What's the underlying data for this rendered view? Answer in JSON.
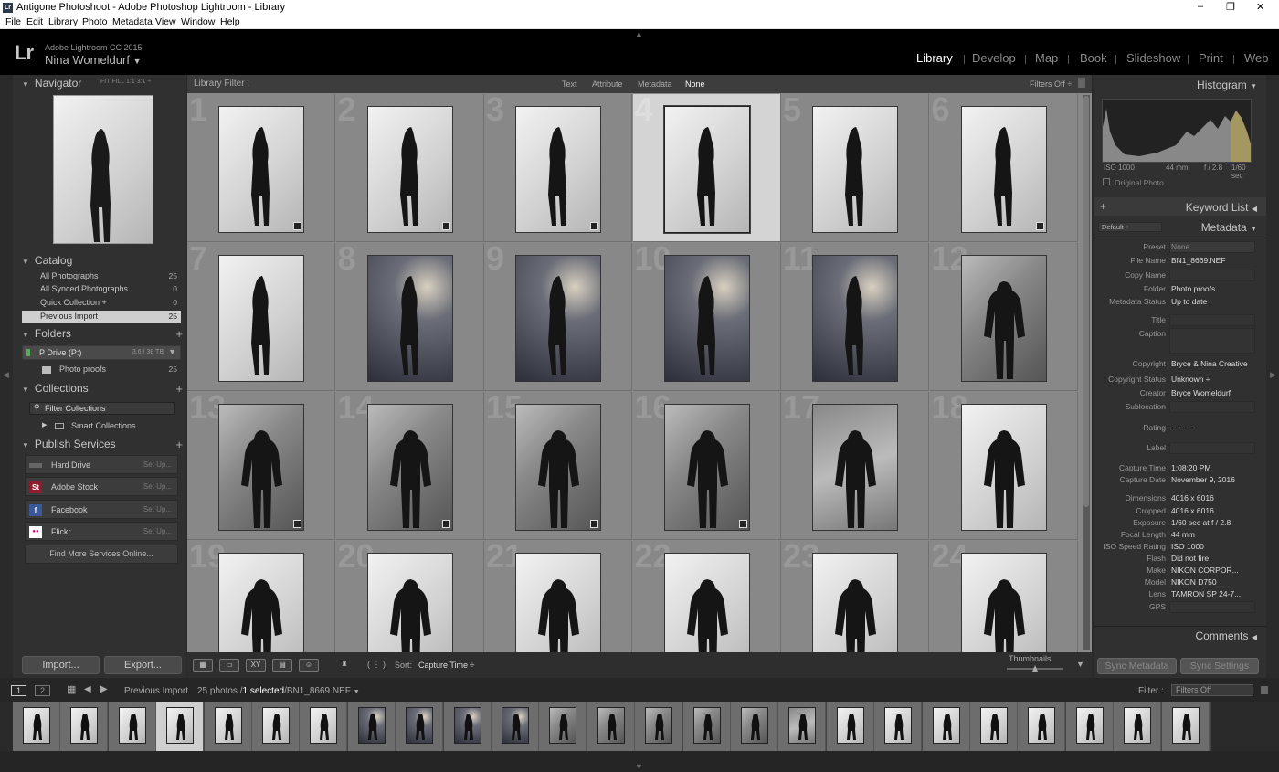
{
  "window": {
    "title": "Antigone Photoshoot - Adobe Photoshop Lightroom - Library",
    "app_icon": "Lr",
    "minimize": "–",
    "maximize": "❐",
    "close": "✕"
  },
  "menu": [
    "File",
    "Edit",
    "Library",
    "Photo",
    "Metadata",
    "View",
    "Window",
    "Help"
  ],
  "identity": {
    "logo": "Lr",
    "version": "Adobe Lightroom CC 2015",
    "user": "Nina Womeldurf",
    "user_chevron": "▼"
  },
  "modules": [
    "Library",
    "Develop",
    "Map",
    "Book",
    "Slideshow",
    "Print",
    "Web"
  ],
  "navigator": {
    "title": "Navigator",
    "zoom": "FIT   FILL   1:1   3:1 ÷"
  },
  "catalog": {
    "title": "Catalog",
    "items": [
      {
        "label": "All Photographs",
        "count": "25"
      },
      {
        "label": "All Synced Photographs",
        "count": "0"
      },
      {
        "label": "Quick Collection +",
        "count": "0"
      },
      {
        "label": "Previous Import",
        "count": "25"
      }
    ]
  },
  "folders": {
    "title": "Folders",
    "drive": "P Drive (P:)",
    "drive_size": "3.6 / 38 TB",
    "folder": "Photo proofs",
    "folder_count": "25"
  },
  "collections": {
    "title": "Collections",
    "filter_placeholder": "Filter Collections",
    "smart": "Smart Collections"
  },
  "publish": {
    "title": "Publish Services",
    "services": [
      {
        "name": "Hard Drive",
        "setup": "Set Up...",
        "icon": "",
        "color": "#666"
      },
      {
        "name": "Adobe Stock",
        "setup": "Set Up...",
        "icon": "St",
        "color": "#8c1d2c"
      },
      {
        "name": "Facebook",
        "setup": "Set Up...",
        "icon": "f",
        "color": "#3b5998"
      },
      {
        "name": "Flickr",
        "setup": "Set Up...",
        "icon": "●●",
        "color": "#ffffff"
      }
    ],
    "find_more": "Find More Services Online..."
  },
  "buttons": {
    "import": "Import...",
    "export": "Export..."
  },
  "library_filter": {
    "label": "Library Filter :",
    "options": [
      "Text",
      "Attribute",
      "Metadata",
      "None"
    ],
    "active": "None",
    "preset": "Filters Off ÷"
  },
  "grid": {
    "cells": [
      {
        "num": "1",
        "bg": "light",
        "badge": true
      },
      {
        "num": "2",
        "bg": "light",
        "badge": true
      },
      {
        "num": "3",
        "bg": "light",
        "badge": true
      },
      {
        "num": "4",
        "bg": "light",
        "badge": false,
        "selected": true
      },
      {
        "num": "5",
        "bg": "light",
        "badge": false
      },
      {
        "num": "6",
        "bg": "light",
        "badge": true
      },
      {
        "num": "7",
        "bg": "light",
        "badge": false
      },
      {
        "num": "8",
        "bg": "dark",
        "badge": false
      },
      {
        "num": "9",
        "bg": "dark",
        "badge": false
      },
      {
        "num": "10",
        "bg": "dark",
        "badge": false
      },
      {
        "num": "11",
        "bg": "dark",
        "badge": false
      },
      {
        "num": "12",
        "bg": "darkgrey",
        "badge": false
      },
      {
        "num": "13",
        "bg": "darkgrey",
        "badge": true
      },
      {
        "num": "14",
        "bg": "darkgrey",
        "badge": true
      },
      {
        "num": "15",
        "bg": "darkgrey",
        "badge": true
      },
      {
        "num": "16",
        "bg": "darkgrey",
        "badge": true
      },
      {
        "num": "17",
        "bg": "grey",
        "badge": false
      },
      {
        "num": "18",
        "bg": "light",
        "badge": false
      },
      {
        "num": "19",
        "bg": "light",
        "badge": false
      },
      {
        "num": "20",
        "bg": "light",
        "badge": false
      },
      {
        "num": "21",
        "bg": "light",
        "badge": false
      },
      {
        "num": "22",
        "bg": "light",
        "badge": false
      },
      {
        "num": "23",
        "bg": "light",
        "badge": false
      },
      {
        "num": "24",
        "bg": "light",
        "badge": false
      }
    ]
  },
  "toolbar": {
    "sort_label": "Sort:",
    "sort_value": "Capture Time ÷",
    "thumbnails": "Thumbnails",
    "spray": "( ⋮ )"
  },
  "histogram": {
    "title": "Histogram",
    "iso": "ISO 1000",
    "focal": "44 mm",
    "aperture": "f / 2.8",
    "shutter": "1/60 sec",
    "original": "Original Photo"
  },
  "keyword_list": {
    "title": "Keyword List",
    "plus": "+"
  },
  "metadata": {
    "title": "Metadata",
    "preset_dropdown": "Default ÷",
    "preset_label": "Preset",
    "preset_value": "None",
    "rows": [
      {
        "k": "File Name",
        "v": "BN1_8669.NEF"
      },
      {
        "k": "Copy Name",
        "v": ""
      },
      {
        "k": "Folder",
        "v": "Photo proofs"
      },
      {
        "k": "Metadata Status",
        "v": "Up to date"
      },
      {
        "k": "Title",
        "v": ""
      },
      {
        "k": "Caption",
        "v": ""
      },
      {
        "k": "Copyright",
        "v": "Bryce & Nina Creative"
      },
      {
        "k": "Copyright Status",
        "v": "Unknown ÷"
      },
      {
        "k": "Creator",
        "v": "Bryce Womeldurf"
      },
      {
        "k": "Sublocation",
        "v": ""
      },
      {
        "k": "Rating",
        "v": "·  ·  ·  ·  ·"
      },
      {
        "k": "Label",
        "v": ""
      },
      {
        "k": "Capture Time",
        "v": "1:08:20 PM"
      },
      {
        "k": "Capture Date",
        "v": "November 9, 2016"
      },
      {
        "k": "Dimensions",
        "v": "4016 x 6016"
      },
      {
        "k": "Cropped",
        "v": "4016 x 6016"
      },
      {
        "k": "Exposure",
        "v": "1/60 sec at f / 2.8"
      },
      {
        "k": "Focal Length",
        "v": "44 mm"
      },
      {
        "k": "ISO Speed Rating",
        "v": "ISO 1000"
      },
      {
        "k": "Flash",
        "v": "Did not fire"
      },
      {
        "k": "Make",
        "v": "NIKON CORPOR..."
      },
      {
        "k": "Model",
        "v": "NIKON D750"
      },
      {
        "k": "Lens",
        "v": "TAMRON SP 24-7..."
      },
      {
        "k": "GPS",
        "v": ""
      }
    ]
  },
  "comments": {
    "title": "Comments"
  },
  "sync": {
    "metadata": "Sync Metadata",
    "settings": "Sync Settings"
  },
  "filmbar": {
    "screen1": "1",
    "screen2": "2",
    "source": "Previous Import",
    "info_prefix": "25 photos /",
    "info_selected": "1 selected",
    "info_file": "/BN1_8669.NEF",
    "info_chevron": "▼",
    "filter_label": "Filter :",
    "filter_value": "Filters Off"
  },
  "filmstrip": [
    "light",
    "light",
    "light",
    "light",
    "light",
    "light",
    "light",
    "dark",
    "dark",
    "dark",
    "dark",
    "darkgrey",
    "darkgrey",
    "darkgrey",
    "darkgrey",
    "darkgrey",
    "grey",
    "light",
    "light",
    "light",
    "light",
    "light",
    "light",
    "light",
    "light"
  ]
}
